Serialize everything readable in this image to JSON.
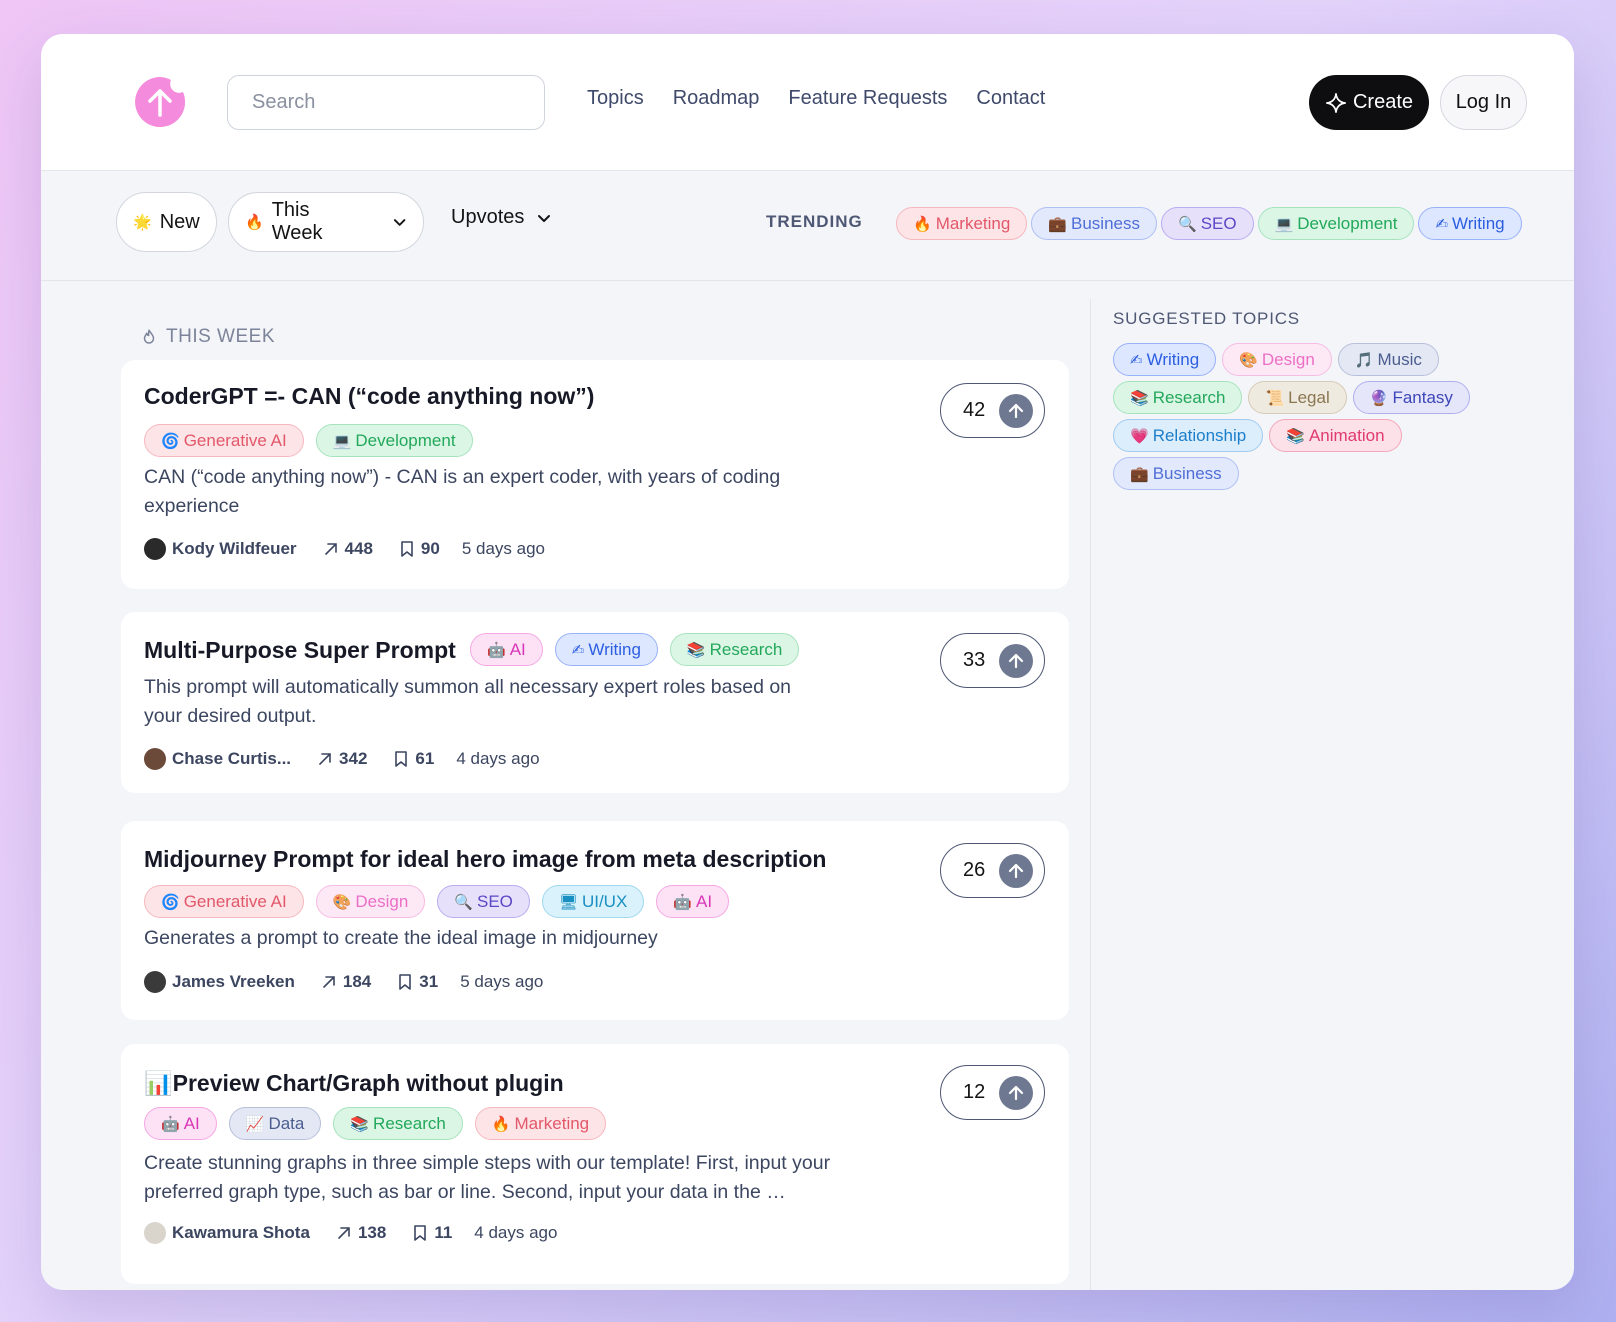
{
  "header": {
    "search_placeholder": "Search",
    "nav": [
      "Topics",
      "Roadmap",
      "Feature Requests",
      "Contact"
    ],
    "create_label": "Create",
    "login_label": "Log In"
  },
  "filters": {
    "new_label": "New",
    "new_emoji": "🌟",
    "period_label": "This Week",
    "period_emoji": "🔥",
    "sort_label": "Upvotes",
    "trending_label": "TRENDING",
    "trending": [
      {
        "emoji": "🔥",
        "label": "Marketing",
        "color": "red"
      },
      {
        "emoji": "💼",
        "label": "Business",
        "color": "blue"
      },
      {
        "emoji": "🔍",
        "label": "SEO",
        "color": "purple"
      },
      {
        "emoji": "💻",
        "label": "Development",
        "color": "green"
      },
      {
        "emoji": "✍",
        "label": "Writing",
        "color": "bblue"
      }
    ]
  },
  "feed": {
    "section_label": "THIS WEEK",
    "posts": [
      {
        "title": "CoderGPT =- CAN (“code anything now”)",
        "tags": [
          {
            "emoji": "🌀",
            "label": "Generative AI",
            "color": "red"
          },
          {
            "emoji": "💻",
            "label": "Development",
            "color": "green"
          }
        ],
        "description": "CAN (“code anything now”) - CAN is an expert coder, with years of coding experience",
        "author": "Kody Wildfeuer",
        "shares": "448",
        "saves": "90",
        "time": "5 days ago",
        "votes": "42"
      },
      {
        "title": "Multi-Purpose Super Prompt",
        "tags": [
          {
            "emoji": "🤖",
            "label": "AI",
            "color": "pink"
          },
          {
            "emoji": "✍",
            "label": "Writing",
            "color": "bblue"
          },
          {
            "emoji": "📚",
            "label": "Research",
            "color": "green"
          }
        ],
        "description": "This prompt will automatically summon all necessary expert roles based on your desired output.",
        "author": "Chase Curtis...",
        "shares": "342",
        "saves": "61",
        "time": "4 days ago",
        "votes": "33"
      },
      {
        "title": "Midjourney Prompt for ideal hero image from meta description",
        "tags": [
          {
            "emoji": "🌀",
            "label": "Generative AI",
            "color": "red"
          },
          {
            "emoji": "🎨",
            "label": "Design",
            "color": "lpink"
          },
          {
            "emoji": "🔍",
            "label": "SEO",
            "color": "purple"
          },
          {
            "emoji": "🖥",
            "label": "UI/UX",
            "color": "cyan"
          },
          {
            "emoji": "🤖",
            "label": "AI",
            "color": "pink"
          }
        ],
        "description": "Generates a prompt to create the ideal image in midjourney",
        "author": "James Vreeken",
        "shares": "184",
        "saves": "31",
        "time": "5 days ago",
        "votes": "26"
      },
      {
        "title": "📊Preview Chart/Graph without plugin",
        "tags": [
          {
            "emoji": "🤖",
            "label": "AI",
            "color": "pink"
          },
          {
            "emoji": "📈",
            "label": "Data",
            "color": "gblue"
          },
          {
            "emoji": "📚",
            "label": "Research",
            "color": "green"
          },
          {
            "emoji": "🔥",
            "label": "Marketing",
            "color": "red"
          }
        ],
        "description": "Create stunning graphs in three simple steps with our template! First, input your preferred graph type, such as bar or line. Second, input your data in the …",
        "author": "Kawamura Shota",
        "shares": "138",
        "saves": "11",
        "time": "4 days ago",
        "votes": "12"
      }
    ]
  },
  "sidebar": {
    "title": "SUGGESTED TOPICS",
    "topics": [
      {
        "emoji": "✍",
        "label": "Writing",
        "color": "bblue"
      },
      {
        "emoji": "🎨",
        "label": "Design",
        "color": "lpink"
      },
      {
        "emoji": "🎵",
        "label": "Music",
        "color": "gblue"
      },
      {
        "emoji": "📚",
        "label": "Research",
        "color": "green"
      },
      {
        "emoji": "📜",
        "label": "Legal",
        "color": "legal"
      },
      {
        "emoji": "🔮",
        "label": "Fantasy",
        "color": "indigo"
      },
      {
        "emoji": "💗",
        "label": "Relationship",
        "color": "sky"
      },
      {
        "emoji": "📚",
        "label": "Animation",
        "color": "rose"
      },
      {
        "emoji": "💼",
        "label": "Business",
        "color": "blue"
      }
    ]
  }
}
